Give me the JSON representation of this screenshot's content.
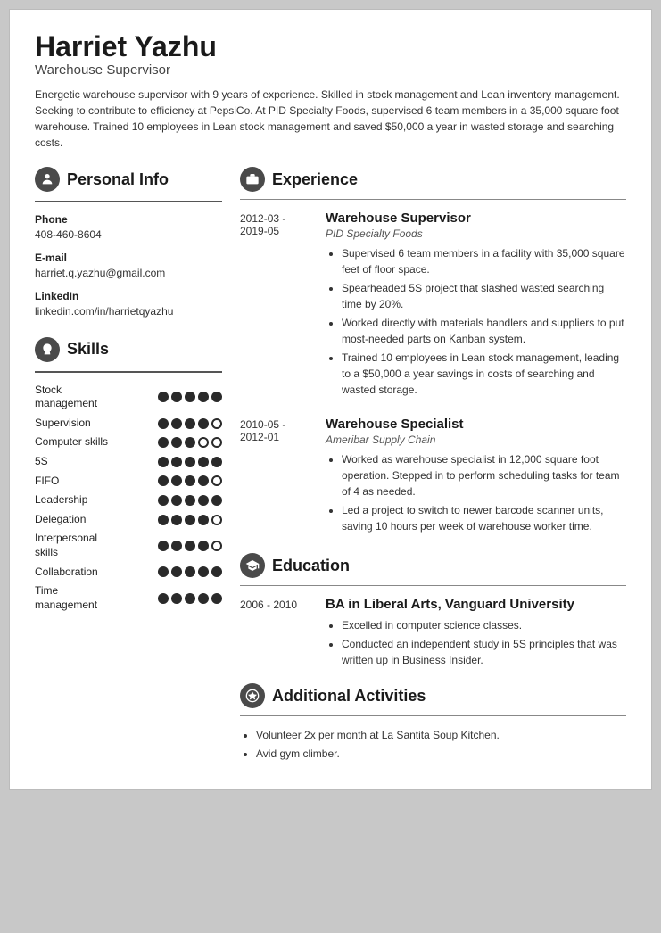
{
  "header": {
    "name": "Harriet Yazhu",
    "title": "Warehouse Supervisor",
    "summary": "Energetic warehouse supervisor with 9 years of experience. Skilled in stock management and Lean inventory management. Seeking to contribute to efficiency at PepsiCo. At PID Specialty Foods, supervised 6 team members in a 35,000 square foot warehouse. Trained 10 employees in Lean stock management and saved $50,000 a year in wasted storage and searching costs."
  },
  "personalInfo": {
    "sectionTitle": "Personal Info",
    "phone_label": "Phone",
    "phone": "408-460-8604",
    "email_label": "E-mail",
    "email": "harriet.q.yazhu@gmail.com",
    "linkedin_label": "LinkedIn",
    "linkedin": "linkedin.com/in/harrietqyazhu"
  },
  "skills": {
    "sectionTitle": "Skills",
    "items": [
      {
        "name": "Stock management",
        "filled": 5,
        "empty": 0
      },
      {
        "name": "Supervision",
        "filled": 4,
        "empty": 1
      },
      {
        "name": "Computer skills",
        "filled": 3,
        "empty": 2
      },
      {
        "name": "5S",
        "filled": 5,
        "empty": 0
      },
      {
        "name": "FIFO",
        "filled": 4,
        "empty": 1
      },
      {
        "name": "Leadership",
        "filled": 5,
        "empty": 0
      },
      {
        "name": "Delegation",
        "filled": 4,
        "empty": 1
      },
      {
        "name": "Interpersonal skills",
        "filled": 4,
        "empty": 1
      },
      {
        "name": "Collaboration",
        "filled": 5,
        "empty": 0
      },
      {
        "name": "Time management",
        "filled": 5,
        "empty": 0
      }
    ]
  },
  "experience": {
    "sectionTitle": "Experience",
    "entries": [
      {
        "dates": "2012-03 - 2019-05",
        "title": "Warehouse Supervisor",
        "company": "PID Specialty Foods",
        "bullets": [
          "Supervised 6 team members in a facility with 35,000 square feet of floor space.",
          "Spearheaded 5S project that slashed wasted searching time by 20%.",
          "Worked directly with materials handlers and suppliers to put most-needed parts on Kanban system.",
          "Trained 10 employees in Lean stock management, leading to a $50,000 a year savings in costs of searching and wasted storage."
        ]
      },
      {
        "dates": "2010-05 - 2012-01",
        "title": "Warehouse Specialist",
        "company": "Ameribar Supply Chain",
        "bullets": [
          "Worked as warehouse specialist in 12,000 square foot operation. Stepped in to perform scheduling tasks for team of 4 as needed.",
          "Led a project to switch to newer barcode scanner units, saving 10 hours per week of warehouse worker time."
        ]
      }
    ]
  },
  "education": {
    "sectionTitle": "Education",
    "entries": [
      {
        "dates": "2006 - 2010",
        "degree": "BA in Liberal Arts, Vanguard University",
        "bullets": [
          "Excelled in computer science classes.",
          "Conducted an independent study in 5S principles that was written up in Business Insider."
        ]
      }
    ]
  },
  "activities": {
    "sectionTitle": "Additional Activities",
    "bullets": [
      "Volunteer 2x per month at La Santita Soup Kitchen.",
      "Avid gym climber."
    ]
  },
  "icons": {
    "person": "👤",
    "briefcase": "💼",
    "graduation": "🎓",
    "star": "⭐"
  }
}
